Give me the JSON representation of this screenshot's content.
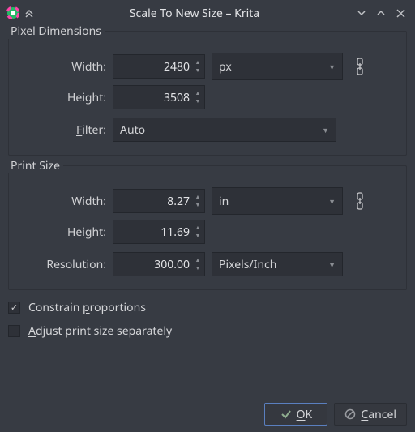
{
  "window": {
    "title": "Scale To New Size – Krita"
  },
  "pixel": {
    "group_title": "Pixel Dimensions",
    "width_label": "Width:",
    "width_value": "2480",
    "height_label": "Height:",
    "height_value": "3508",
    "unit": "px",
    "filter_label_pre": "F",
    "filter_label_post": "ilter:",
    "filter_value": "Auto"
  },
  "print": {
    "group_title": "Print Size",
    "width_label_pre": "Wid",
    "width_label_u": "t",
    "width_label_post": "h:",
    "width_value": "8.27",
    "height_label_pre": "Hei",
    "height_label_u": "g",
    "height_label_post": "ht:",
    "height_value": "11.69",
    "unit": "in",
    "res_label": "Resolution:",
    "res_value": "300.00",
    "res_unit": "Pixels/Inch"
  },
  "options": {
    "constrain_pre": "Constrain ",
    "constrain_u": "p",
    "constrain_post": "roportions",
    "adjust_u": "A",
    "adjust_post": "djust print size separately"
  },
  "buttons": {
    "ok_u": "O",
    "ok_post": "K",
    "cancel_u": "C",
    "cancel_post": "ancel"
  }
}
